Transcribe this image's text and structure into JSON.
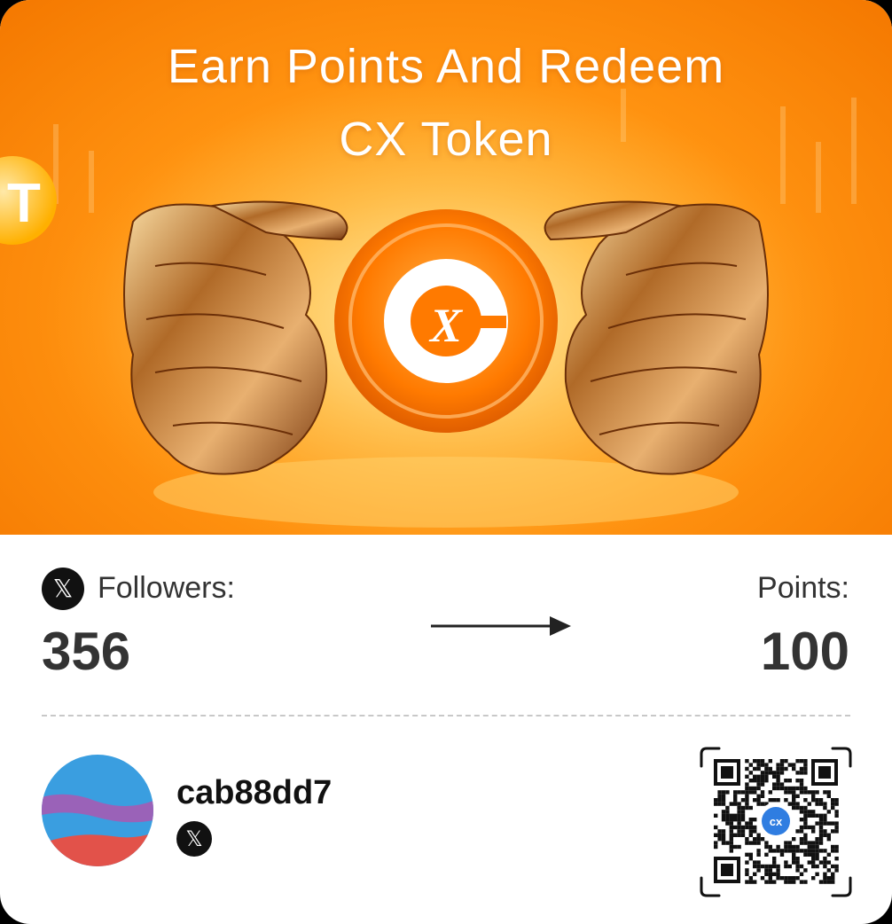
{
  "banner": {
    "title_line1": "Earn Points And Redeem",
    "title_line2": "CX Token",
    "coin_glyph": "X"
  },
  "stats": {
    "followers_label": "Followers:",
    "followers_value": "356",
    "points_label": "Points:",
    "points_value": "100",
    "x_glyph": "𝕏"
  },
  "user": {
    "username": "cab88dd7",
    "x_glyph": "𝕏"
  },
  "qr": {
    "center_text": "cx"
  },
  "colors": {
    "banner_orange": "#ff9210",
    "text_dark": "#333333",
    "x_badge": "#111111",
    "avatar_blue": "#3a9ee0",
    "avatar_purple": "#9a62b8",
    "avatar_red": "#e2524a",
    "qr_accent": "#2f7de1"
  }
}
